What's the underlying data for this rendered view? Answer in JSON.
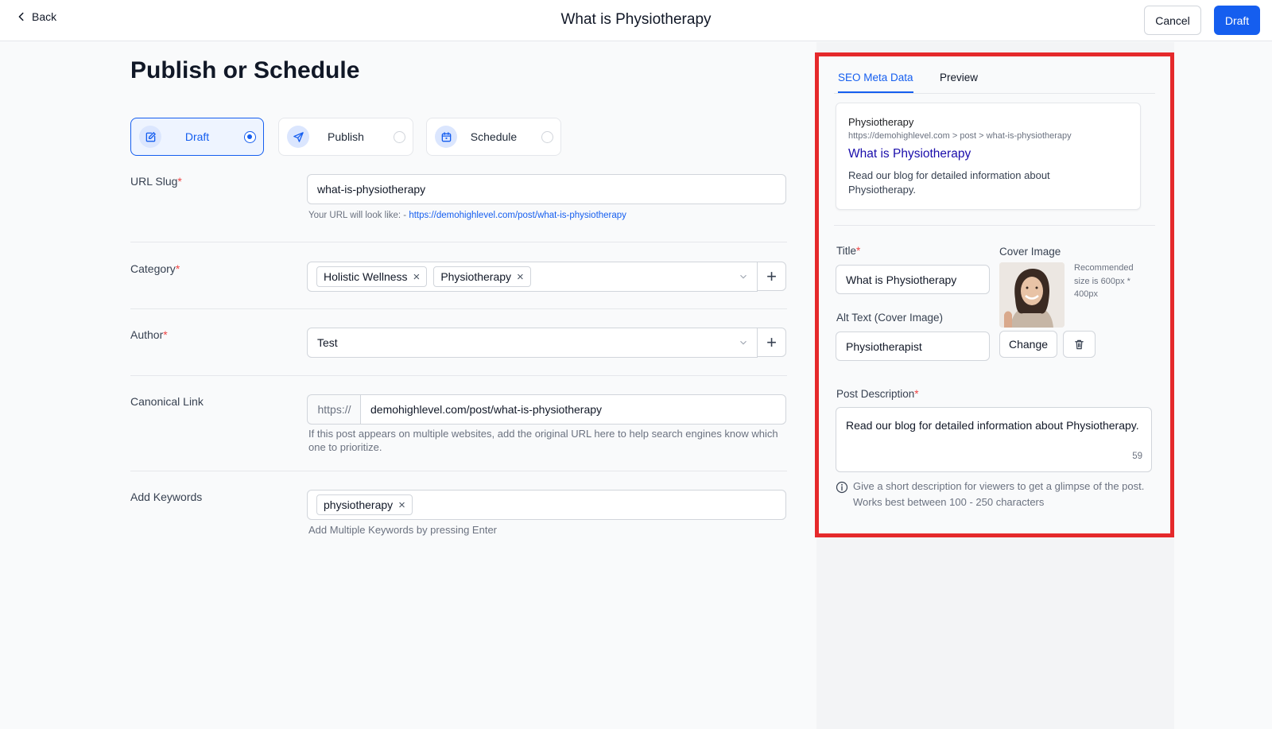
{
  "header": {
    "back_label": "Back",
    "title": "What is Physiotherapy",
    "cancel_label": "Cancel",
    "draft_label": "Draft"
  },
  "main": {
    "title": "Publish or Schedule",
    "status_options": [
      {
        "label": "Draft",
        "icon": "edit-icon",
        "selected": true
      },
      {
        "label": "Publish",
        "icon": "send-icon",
        "selected": false
      },
      {
        "label": "Schedule",
        "icon": "calendar-icon",
        "selected": false
      }
    ],
    "url_slug": {
      "label": "URL Slug",
      "required_mark": "*",
      "value": "what-is-physiotherapy",
      "helper_prefix": "Your URL will look like: - ",
      "helper_link": "https://demohighlevel.com/post/what-is-physiotherapy"
    },
    "category": {
      "label": "Category",
      "required_mark": "*",
      "chips": [
        "Holistic Wellness",
        "Physiotherapy"
      ],
      "add_label": "+"
    },
    "author": {
      "label": "Author",
      "required_mark": "*",
      "value": "Test",
      "add_label": "+"
    },
    "canonical": {
      "label": "Canonical Link",
      "prefix": "https://",
      "value": "demohighlevel.com/post/what-is-physiotherapy",
      "helper": "If this post appears on multiple websites, add the original URL here to help search engines know which one to prioritize."
    },
    "keywords": {
      "label": "Add Keywords",
      "chips": [
        "physiotherapy"
      ],
      "helper": "Add Multiple Keywords by pressing Enter"
    },
    "chip_remove": "×"
  },
  "seo_panel": {
    "tabs": [
      "SEO Meta Data",
      "Preview"
    ],
    "active_tab": 0,
    "search_preview": {
      "site_name": "Physiotherapy",
      "url": "https://demohighlevel.com > post > what-is-physiotherapy",
      "title": "What is Physiotherapy",
      "description": "Read our blog for detailed information about Physiotherapy."
    },
    "title_label": "Title",
    "title_value": "What is Physiotherapy",
    "alt_label": "Alt Text (Cover Image)",
    "alt_value": "Physiotherapist",
    "cover_label": "Cover Image",
    "cover_recommendation": "Recommended size is 600px * 400px",
    "change_label": "Change",
    "description_label": "Post Description",
    "description_value": "Read our blog for detailed information about Physiotherapy.",
    "description_count": "59",
    "description_hint": "Give a short description for viewers to get a glimpse of the post. Works best between 100 - 250 characters",
    "required_mark": "*"
  },
  "colors": {
    "accent": "#155eef",
    "required": "#ef4444",
    "highlight_border": "#e5292b",
    "link_title": "#1a0dab"
  }
}
